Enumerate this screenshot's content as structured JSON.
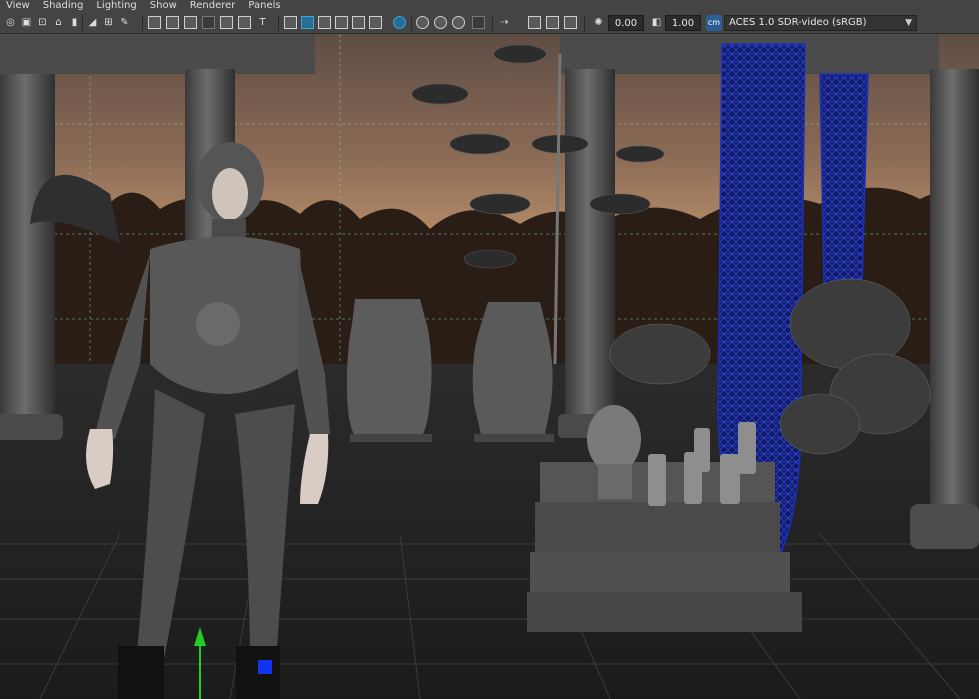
{
  "menu": {
    "items": [
      "View",
      "Shading",
      "Lighting",
      "Show",
      "Renderer",
      "Panels"
    ]
  },
  "toolbar": {
    "exposure_value": "0.00",
    "gamma_value": "1.00",
    "color_management_badge": "cm",
    "color_space": "ACES 1.0 SDR-video (sRGB)",
    "icons": [
      "select-camera-icon",
      "camera-attributes-icon",
      "bookmark-icon",
      "image-plane-icon",
      "grid-icon",
      "film-gate-icon",
      "resolution-gate-icon",
      "gate-mask-icon",
      "field-chart-icon",
      "safe-action-icon",
      "safe-title-icon",
      "wireframe-icon",
      "smooth-shade-icon",
      "wireframe-on-shaded-icon",
      "textured-icon",
      "use-all-lights-icon",
      "shadows-icon",
      "ambient-occlusion-icon",
      "motion-blur-icon",
      "anti-aliasing-icon",
      "isolate-select-icon",
      "xray-icon",
      "xray-joints-icon",
      "backface-culling-icon",
      "exposure-icon",
      "gamma-icon"
    ]
  },
  "colors": {
    "ui_background": "#444444",
    "viewport_floor": "#242424",
    "selection_wire": "#1c2fb8",
    "manipulator_y": "#22cc22",
    "manipulator_handle": "#1133ee",
    "color_management_badge": "#2b5f93"
  }
}
